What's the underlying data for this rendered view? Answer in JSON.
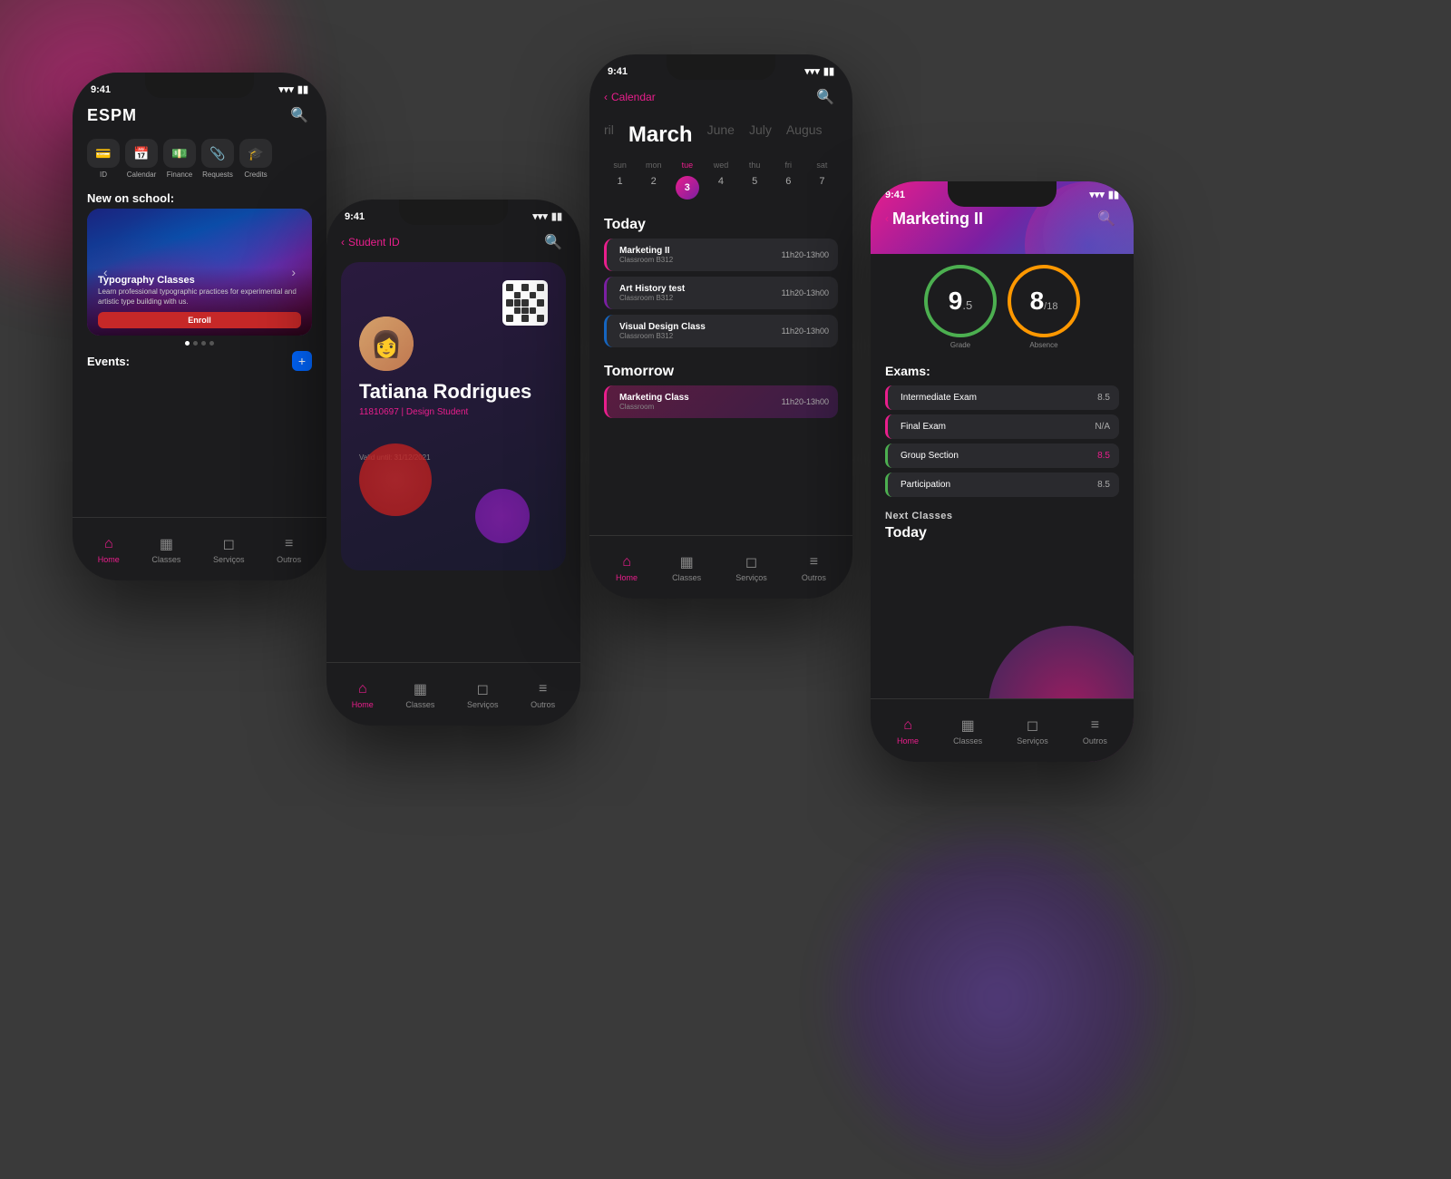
{
  "scene": {
    "background": "#3a3a3a"
  },
  "phone1": {
    "status_time": "9:41",
    "logo": "ESPM",
    "search_icon": "🔍",
    "quick_items": [
      {
        "icon": "💳",
        "label": "ID"
      },
      {
        "icon": "📅",
        "label": "Calendar"
      },
      {
        "icon": "💵",
        "label": "Finance"
      },
      {
        "icon": "📎",
        "label": "Requests"
      },
      {
        "icon": "🎓",
        "label": "Credits"
      }
    ],
    "new_on_school": "New on school:",
    "banner_title": "Typography Classes",
    "banner_desc": "Learn professional typographic practices for experimental and artistic type building with us.",
    "enroll_label": "Enroll",
    "events_label": "Events:",
    "nav": [
      {
        "label": "Home",
        "active": true
      },
      {
        "label": "Classes",
        "active": false
      },
      {
        "label": "Serviços",
        "active": false
      },
      {
        "label": "Outros",
        "active": false
      }
    ]
  },
  "phone2": {
    "status_time": "9:41",
    "back_label": "Student ID",
    "student_name": "Tatiana Rodrigues",
    "student_id": "11810697",
    "student_role": "Design Student",
    "valid_until": "Valid until: 31/12/2021",
    "nav": [
      {
        "label": "Home",
        "active": true
      },
      {
        "label": "Classes",
        "active": false
      },
      {
        "label": "Serviços",
        "active": false
      },
      {
        "label": "Outros",
        "active": false
      }
    ]
  },
  "phone3": {
    "status_time": "9:41",
    "back_label": "Calendar",
    "months": [
      "ril",
      "March",
      "June",
      "July",
      "Augus"
    ],
    "active_month": "March",
    "week_days": [
      "sun",
      "mon",
      "tue",
      "wed",
      "thu",
      "fri",
      "sat"
    ],
    "dates": [
      1,
      2,
      3,
      4,
      5,
      6,
      7
    ],
    "today_date": 3,
    "today_label": "Today",
    "tomorrow_label": "Tomorrow",
    "today_classes": [
      {
        "name": "Marketing II",
        "room": "Classroom B312",
        "time": "11h20-13h00"
      },
      {
        "name": "Art History test",
        "room": "Classroom B312",
        "time": "11h20-13h00"
      },
      {
        "name": "Visual Design Class",
        "room": "Classroom B312",
        "time": "11h20-13h00"
      }
    ],
    "tomorrow_classes": [
      {
        "name": "Marketing Class",
        "room": "Classroom",
        "time": "11h20-13h00"
      }
    ],
    "nav": [
      {
        "label": "Home",
        "active": true
      },
      {
        "label": "Classes",
        "active": false
      },
      {
        "label": "Serviços",
        "active": false
      },
      {
        "label": "Outros",
        "active": false
      }
    ]
  },
  "phone4": {
    "status_time": "9:41",
    "back_label": "Marketing II",
    "grade_value": "9",
    "grade_decimal": ".5",
    "grade_label": "Grade",
    "absence_value": "8",
    "absence_total": "/18",
    "absence_label": "Absence",
    "exams_title": "Exams:",
    "exams": [
      {
        "name": "Intermediate Exam",
        "grade": "8.5"
      },
      {
        "name": "Final Exam",
        "grade": "N/A"
      },
      {
        "name": "Group Section",
        "grade": "8.5"
      },
      {
        "name": "Participation",
        "grade": "8.5"
      }
    ],
    "next_classes_label": "Next Classes",
    "today_label": "Today",
    "nav": [
      {
        "label": "Home",
        "active": true
      },
      {
        "label": "Classes",
        "active": false
      },
      {
        "label": "Serviços",
        "active": false
      },
      {
        "label": "Outros",
        "active": false
      }
    ]
  }
}
